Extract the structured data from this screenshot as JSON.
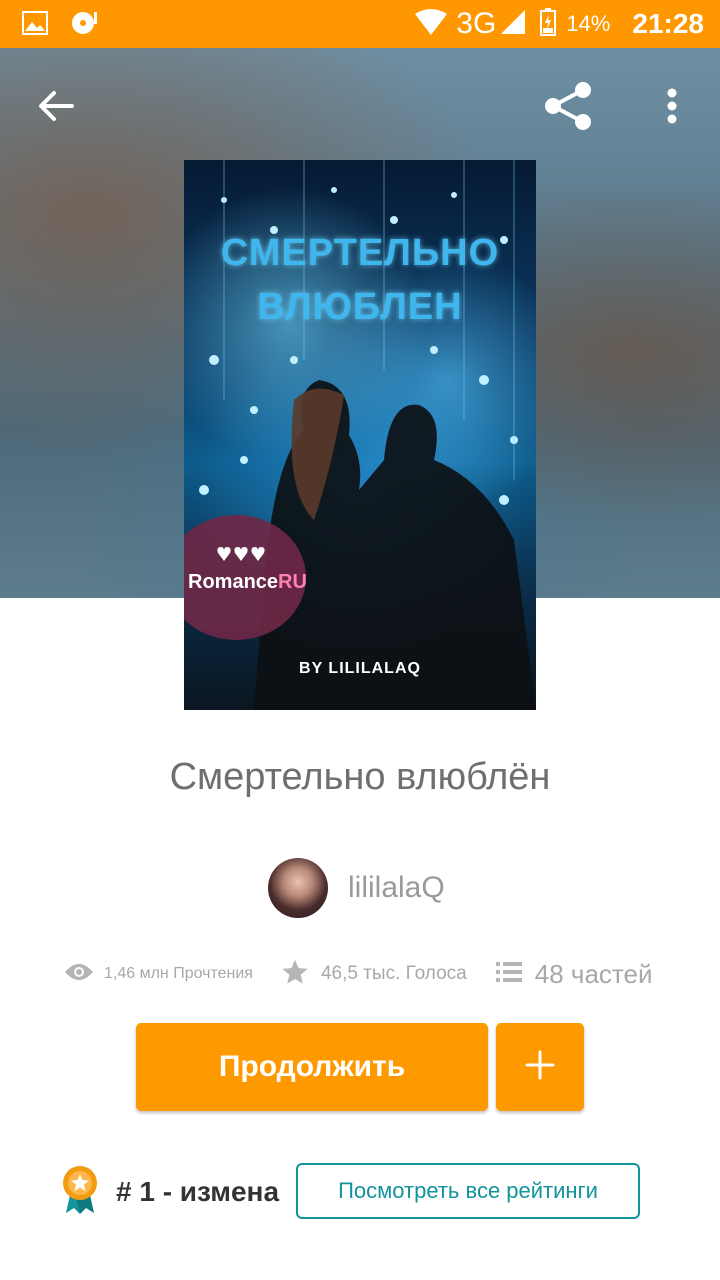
{
  "status_bar": {
    "network": "3G",
    "battery": "14%",
    "time": "21:28"
  },
  "book": {
    "cover_title_line1": "СМЕРТЕЛЬНО",
    "cover_title_line2": "ВЛЮБЛЕН",
    "cover_byline": "BY LILILALAQ",
    "cover_badge_brand": "Romance",
    "cover_badge_brand_accent": "RU",
    "title": "Смертельно влюблён",
    "author": "lililalaQ"
  },
  "stats": {
    "reads": "1,46 млн Прочтения",
    "votes": "46,5 тыс. Голоса",
    "parts": "48 частей"
  },
  "actions": {
    "continue_label": "Продолжить",
    "add_label": "+"
  },
  "ranking": {
    "text": "# 1 - измена",
    "view_all_label": "Посмотреть все рейтинги"
  },
  "colors": {
    "accent": "#ff9800",
    "teal": "#11949c"
  }
}
